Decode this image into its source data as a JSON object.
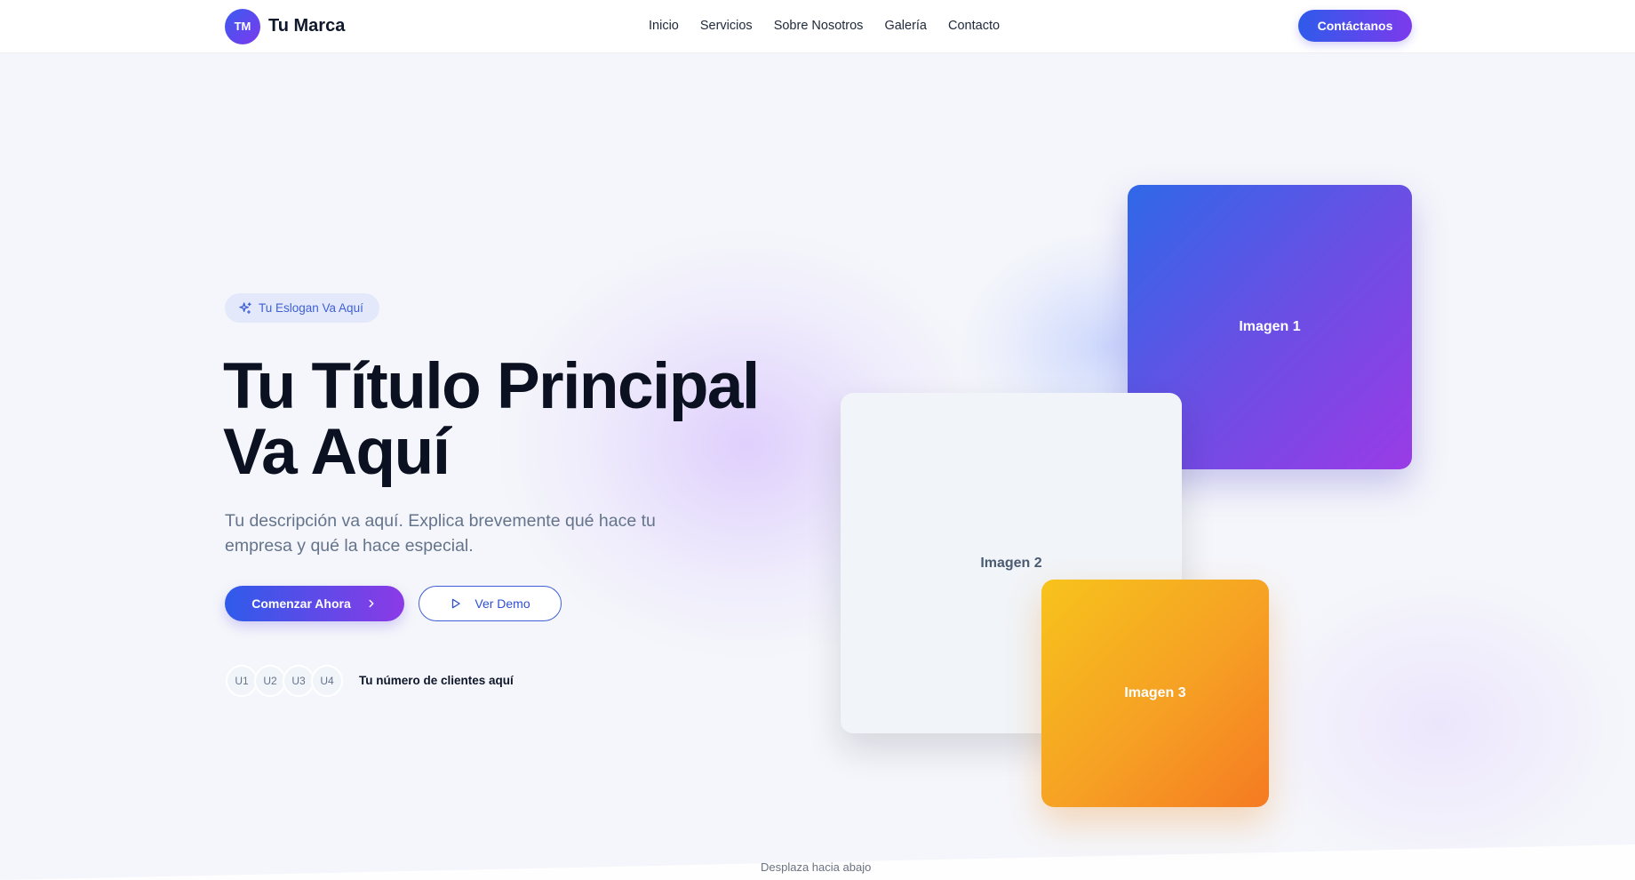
{
  "header": {
    "logo_initials": "TM",
    "brand_name": "Tu Marca",
    "nav": [
      "Inicio",
      "Servicios",
      "Sobre Nosotros",
      "Galería",
      "Contacto"
    ],
    "cta_label": "Contáctanos"
  },
  "hero": {
    "badge_icon": "sparkles-icon",
    "badge": "Tu Eslogan Va Aquí",
    "title_line1": "Tu Título Principal",
    "title_line2": "Va Aquí",
    "description": "Tu descripción va aquí. Explica brevemente qué hace tu empresa y qué la hace especial.",
    "primary_button": "Comenzar Ahora",
    "primary_button_icon": "chevron-right-icon",
    "secondary_button": "Ver Demo",
    "secondary_button_icon": "play-icon",
    "avatars": [
      "U1",
      "U2",
      "U3",
      "U4"
    ],
    "clients_text": "Tu número de clientes aquí"
  },
  "gallery": {
    "image1": "Imagen 1",
    "image2": "Imagen 2",
    "image3": "Imagen 3"
  },
  "scroll_hint": "Desplaza hacia abajo",
  "colors": {
    "accent_blue": "#2f5bea",
    "accent_purple": "#7c3aed",
    "orange": "#f57a22",
    "yellow": "#f7c31c"
  }
}
